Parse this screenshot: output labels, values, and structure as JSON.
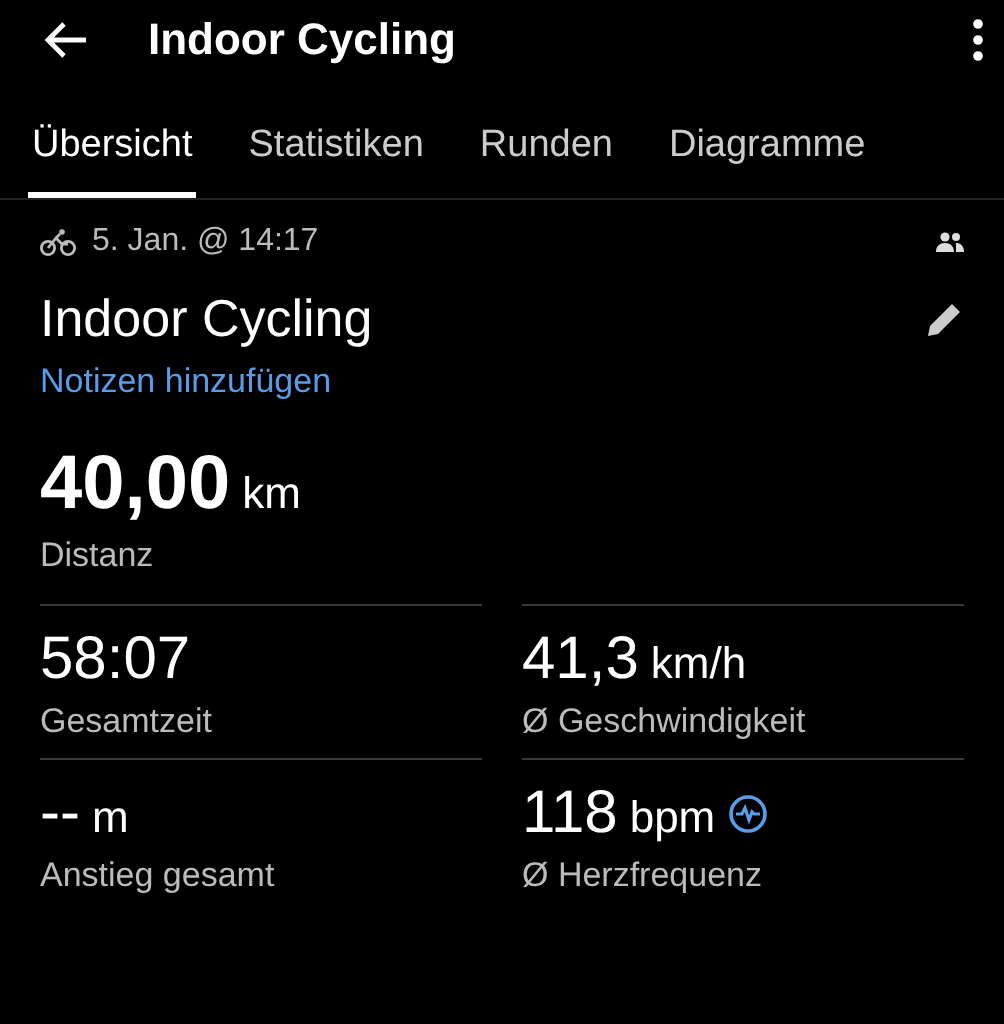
{
  "app_bar": {
    "title": "Indoor Cycling"
  },
  "tabs": [
    {
      "label": "Übersicht",
      "selected": true
    },
    {
      "label": "Statistiken",
      "selected": false
    },
    {
      "label": "Runden",
      "selected": false
    },
    {
      "label": "Diagramme",
      "selected": false
    }
  ],
  "activity": {
    "date": "5. Jan. @ 14:17",
    "name": "Indoor Cycling",
    "notes_link": "Notizen hinzufügen"
  },
  "distance": {
    "value": "40,00",
    "unit": "km",
    "label": "Distanz"
  },
  "stats": [
    {
      "value": "58:07",
      "label": "Gesamtzeit",
      "kind": "plain"
    },
    {
      "value": "41,3",
      "unit": "km/h",
      "label": "Ø Geschwindigkeit",
      "kind": "plain"
    },
    {
      "value": "--",
      "unit": "m",
      "label": "Anstieg gesamt",
      "kind": "plain"
    },
    {
      "value": "118",
      "unit": "bpm",
      "label": "Ø Herzfrequenz",
      "kind": "heart_rate"
    }
  ]
}
